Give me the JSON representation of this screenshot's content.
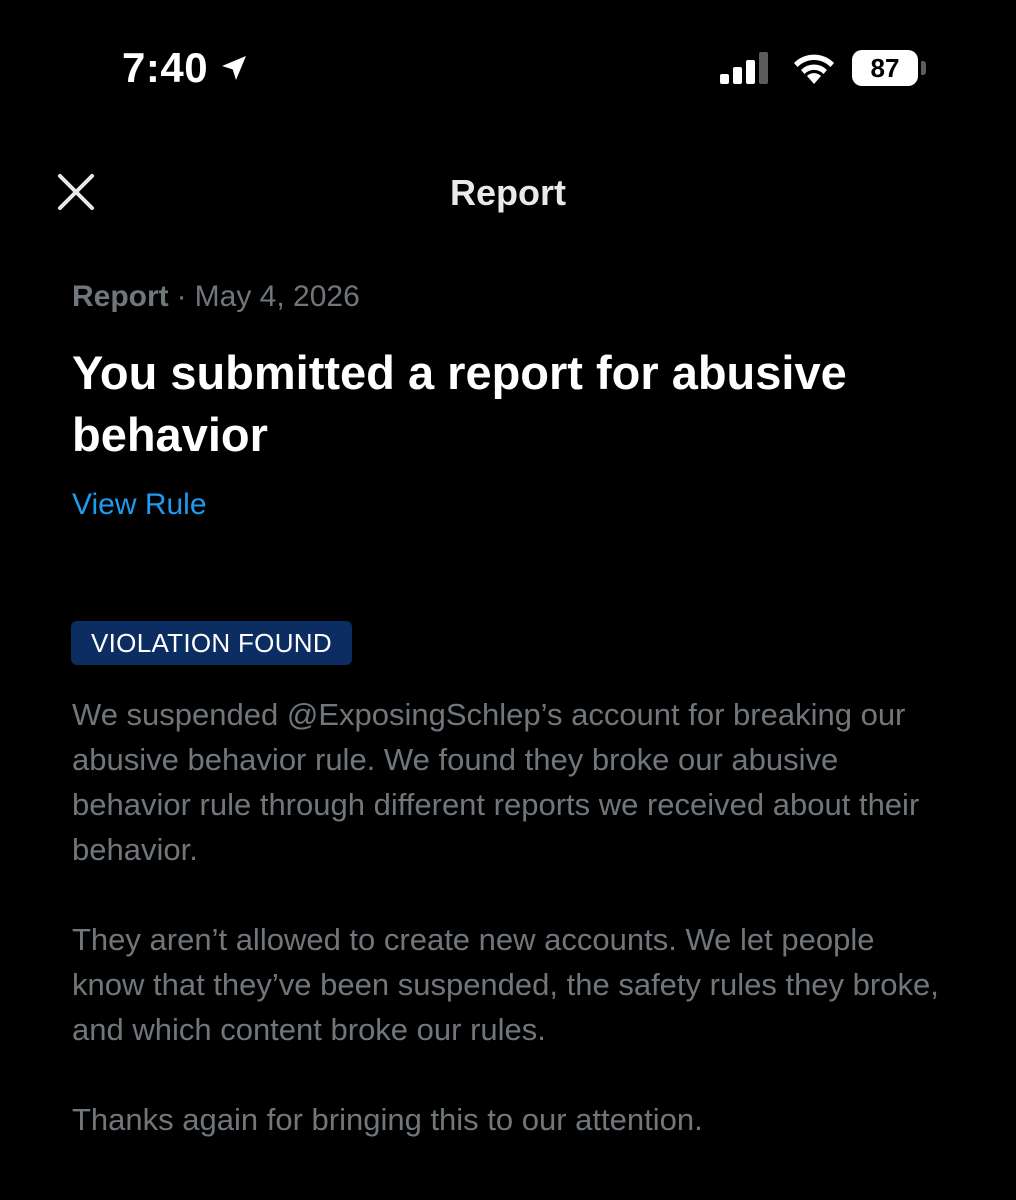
{
  "status_bar": {
    "time": "7:40",
    "battery_level": "87",
    "icons": [
      "location-arrow-icon",
      "cellular-signal-icon",
      "wifi-icon",
      "battery-icon"
    ]
  },
  "header": {
    "title": "Report",
    "close_icon": "close-icon"
  },
  "report": {
    "type_label": "Report",
    "separator": "·",
    "date": "May 4, 2026",
    "headline": "You submitted a report for abusive behavior",
    "view_rule_label": "View Rule",
    "status_badge": "VIOLATION FOUND",
    "paragraphs": [
      "We suspended @ExposingSchlep’s account for breaking our abusive behavior rule. We found they broke our abusive behavior rule through different reports we received about their behavior.",
      "They aren’t allowed to create new accounts. We let people know that they’ve been suspended, the safety rules they broke, and which content broke our rules.",
      "Thanks again for bringing this to our attention."
    ]
  },
  "colors": {
    "background": "#000000",
    "primary_text": "#e7e9ea",
    "secondary_text": "#71767b",
    "link": "#1d9bf0",
    "badge_background": "#0b2d62"
  }
}
